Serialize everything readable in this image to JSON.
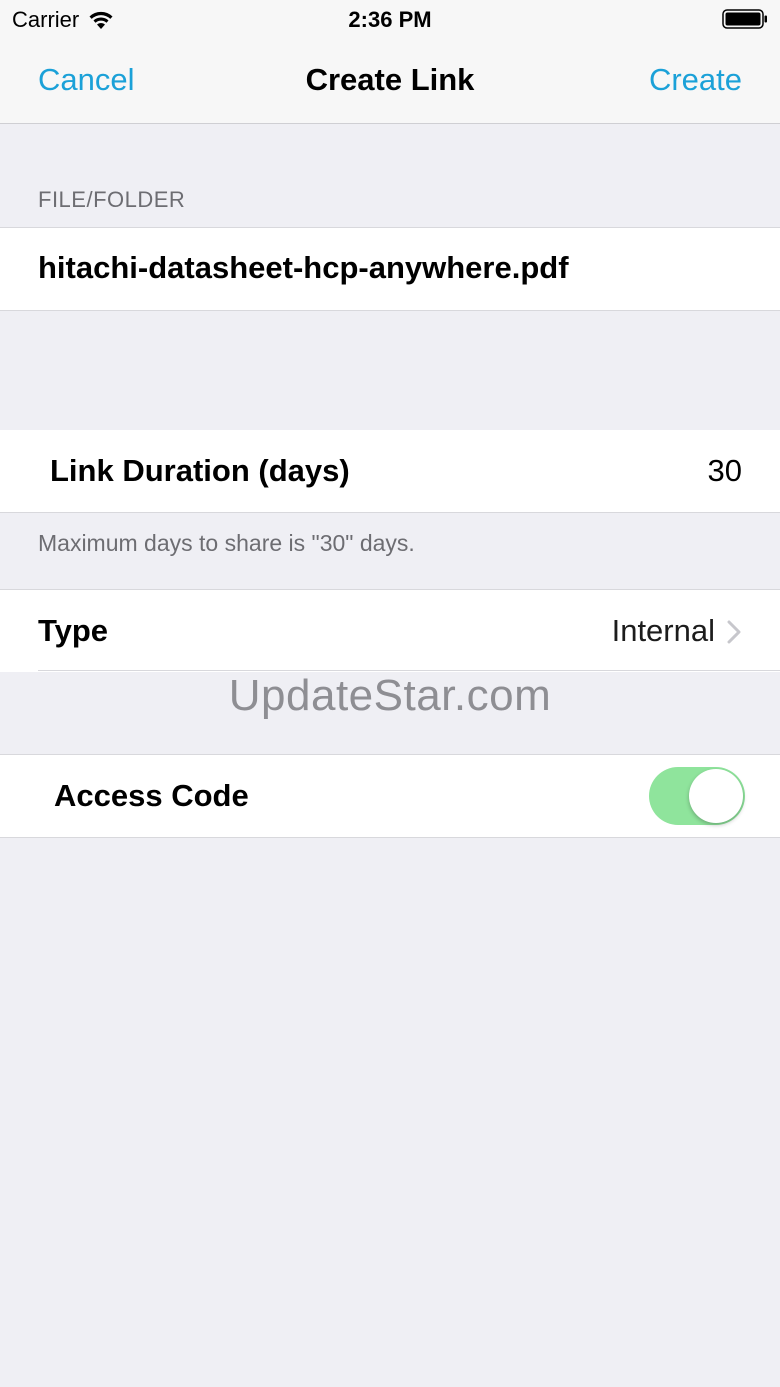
{
  "status_bar": {
    "carrier": "Carrier",
    "time": "2:36 PM",
    "wifi_icon": "wifi-icon",
    "battery_icon": "battery-icon"
  },
  "nav": {
    "cancel_label": "Cancel",
    "title": "Create Link",
    "create_label": "Create",
    "accent_color": "#1ba1d8"
  },
  "file_section": {
    "header": "FILE/FOLDER",
    "file_name": "hitachi-datasheet-hcp-anywhere.pdf"
  },
  "duration": {
    "label": "Link Duration (days)",
    "value": "30",
    "footnote": "Maximum days to share is \"30\" days."
  },
  "type": {
    "label": "Type",
    "value": "Internal",
    "chevron_icon": "chevron-right-icon"
  },
  "watermark": "UpdateStar.com",
  "access_code": {
    "label": "Access Code",
    "enabled": true,
    "toggle_color": "#8fe49c"
  }
}
